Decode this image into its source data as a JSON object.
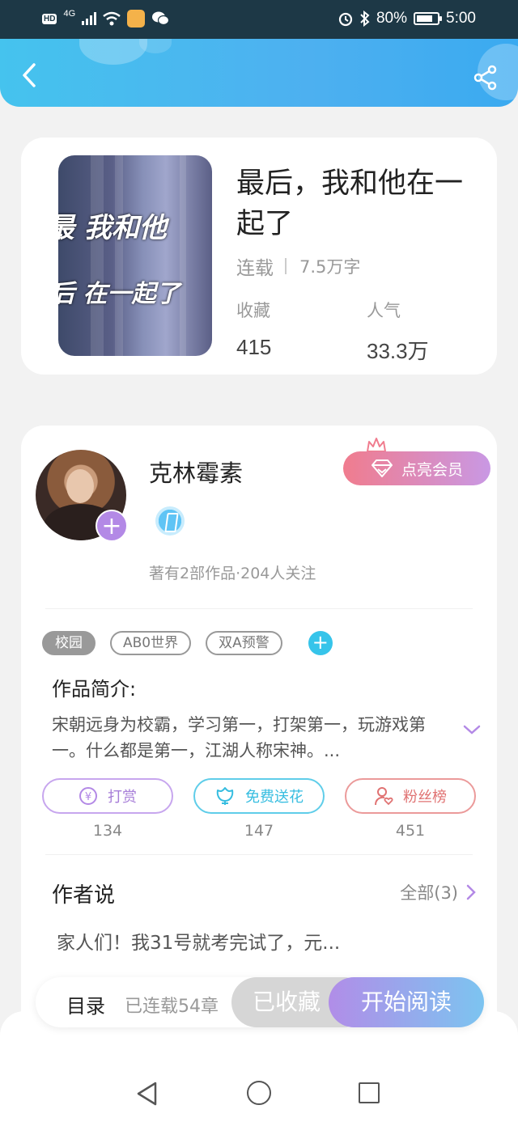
{
  "status_bar": {
    "network": "4G",
    "battery": "80%",
    "battery_level": 0.8,
    "time": "5:00"
  },
  "header": {
    "back_icon": "chevron-left-icon",
    "share_icon": "share-icon"
  },
  "book": {
    "title": "最后，我和他在一起了",
    "cover_text_1": "最 我和他",
    "cover_text_2": "后 在一起了",
    "status": "连载",
    "word_count": "7.5万字",
    "favorites_label": "收藏",
    "favorites_value": "415",
    "popularity_label": "人气",
    "popularity_value": "33.3万"
  },
  "author": {
    "name": "克林霉素",
    "meta": "著有2部作品·204人关注",
    "follow_symbol": "+",
    "vip_button": "点亮会员"
  },
  "tags": {
    "items": [
      "校园",
      "AB0世界",
      "双A预警"
    ],
    "add_symbol": "+"
  },
  "intro": {
    "title": "作品简介:",
    "text": "宋朝远身为校霸，学习第一，打架第一，玩游戏第一。什么都是第一，江湖人称宋神。..."
  },
  "actions": {
    "reward_label": "打赏",
    "reward_count": "134",
    "flower_label": "免费送花",
    "flower_count": "147",
    "fans_label": "粉丝榜",
    "fans_count": "451"
  },
  "author_says": {
    "title": "作者说",
    "all_label": "全部(3)",
    "text": "家人们！我31号就考完试了，元..."
  },
  "bottom_bar": {
    "toc_label": "目录",
    "serial_label": "已连载54章",
    "favorited_label": "已收藏",
    "read_label": "开始阅读"
  },
  "colors": {
    "header_blue": "#45c3ee",
    "purple": "#b389e6",
    "cyan": "#36c4ea",
    "rose": "#e07272"
  }
}
